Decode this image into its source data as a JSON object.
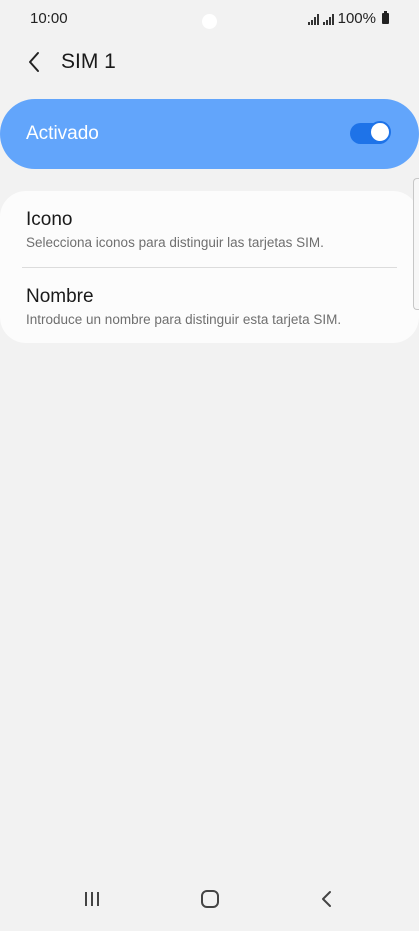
{
  "status_bar": {
    "time": "10:00",
    "battery": "100%"
  },
  "header": {
    "title": "SIM 1"
  },
  "activated": {
    "label": "Activado",
    "enabled": true
  },
  "settings": [
    {
      "title": "Icono",
      "description": "Selecciona iconos para distinguir las tarjetas SIM."
    },
    {
      "title": "Nombre",
      "description": "Introduce un nombre para distinguir esta tarjeta SIM."
    }
  ],
  "colors": {
    "background": "#f2f2f2",
    "accent_card": "#62a5fb",
    "toggle_on": "#1e73e8",
    "card": "#fcfcfc"
  },
  "icons": {
    "back": "chevron-left-icon",
    "recents": "recents-icon",
    "home": "home-icon",
    "nav_back": "nav-back-icon"
  }
}
